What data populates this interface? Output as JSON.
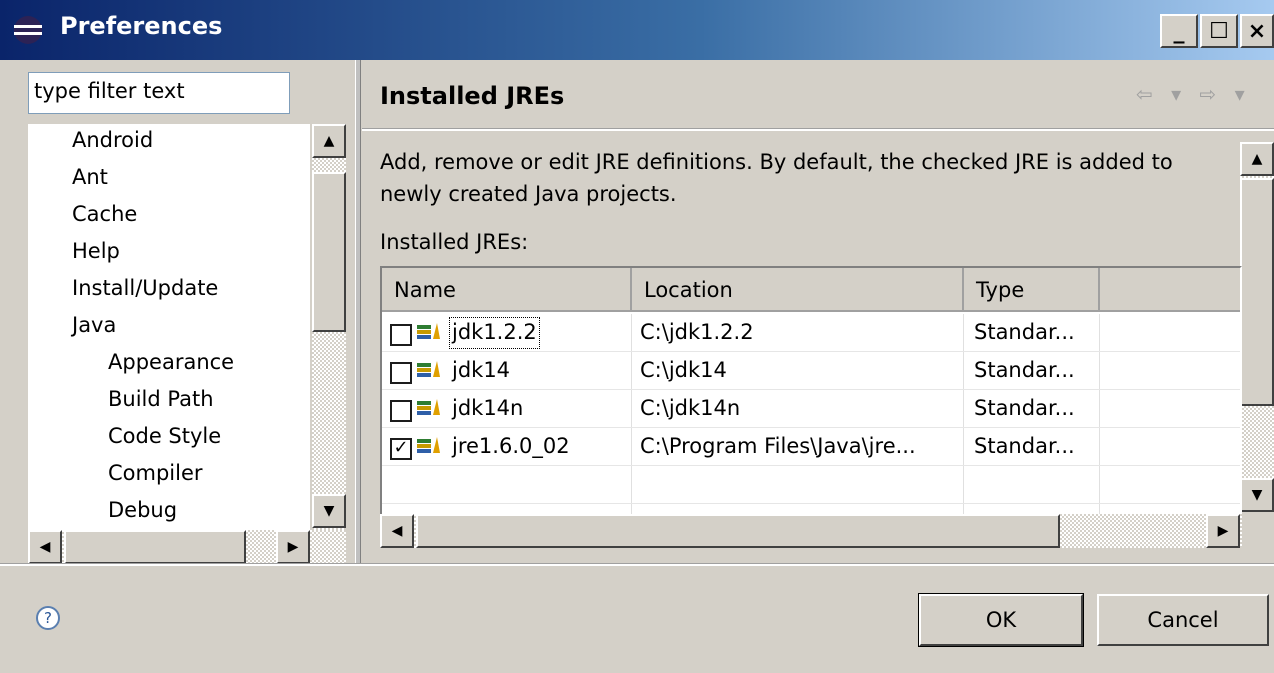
{
  "window": {
    "title": "Preferences",
    "controls": {
      "minimize": "_",
      "maximize": "☐",
      "close": "×"
    }
  },
  "sidebar": {
    "filter_placeholder": "type filter text",
    "items": [
      {
        "label": "Android",
        "level": 0
      },
      {
        "label": "Ant",
        "level": 0
      },
      {
        "label": "Cache",
        "level": 0
      },
      {
        "label": "Help",
        "level": 0
      },
      {
        "label": "Install/Update",
        "level": 0
      },
      {
        "label": "Java",
        "level": 0
      },
      {
        "label": "Appearance",
        "level": 1
      },
      {
        "label": "Build Path",
        "level": 1
      },
      {
        "label": "Code Style",
        "level": 1
      },
      {
        "label": "Compiler",
        "level": 1
      },
      {
        "label": "Debug",
        "level": 1
      }
    ]
  },
  "page": {
    "title": "Installed JREs",
    "nav": "⇦ ▾ ⇨ ▾",
    "description": "Add, remove or edit JRE definitions. By default, the checked JRE is added to newly created Java projects.",
    "list_label": "Installed JREs:"
  },
  "table": {
    "columns": [
      "Name",
      "Location",
      "Type"
    ],
    "rows": [
      {
        "checked": false,
        "name": "jdk1.2.2",
        "location": "C:\\jdk1.2.2",
        "type": "Standar..."
      },
      {
        "checked": false,
        "name": "jdk14",
        "location": "C:\\jdk14",
        "type": "Standar..."
      },
      {
        "checked": false,
        "name": "jdk14n",
        "location": "C:\\jdk14n",
        "type": "Standar..."
      },
      {
        "checked": true,
        "name": "jre1.6.0_02",
        "location": "C:\\Program Files\\Java\\jre...",
        "type": "Standar..."
      }
    ]
  },
  "footer": {
    "help": "?",
    "ok_label": "OK",
    "cancel_label": "Cancel"
  }
}
